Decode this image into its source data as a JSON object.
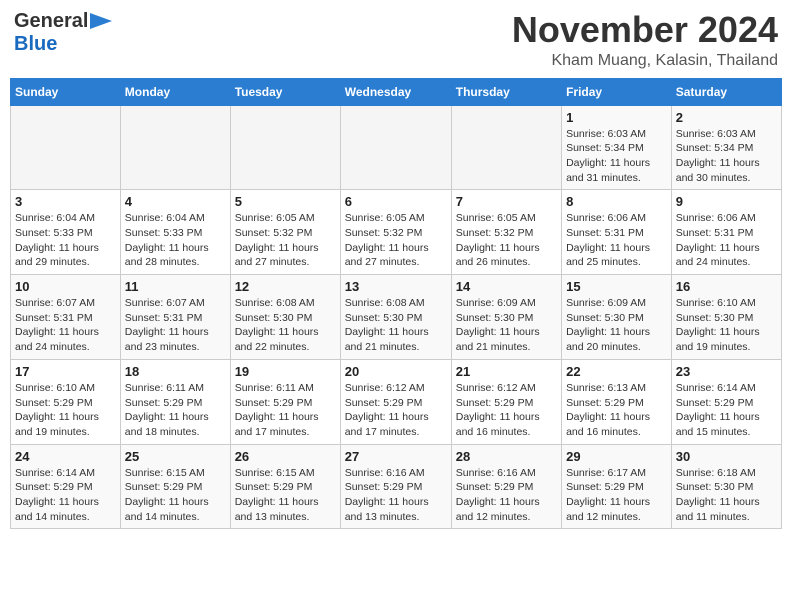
{
  "header": {
    "logo_general": "General",
    "logo_blue": "Blue",
    "month_title": "November 2024",
    "location": "Kham Muang, Kalasin, Thailand"
  },
  "weekdays": [
    "Sunday",
    "Monday",
    "Tuesday",
    "Wednesday",
    "Thursday",
    "Friday",
    "Saturday"
  ],
  "weeks": [
    [
      {
        "day": "",
        "info": ""
      },
      {
        "day": "",
        "info": ""
      },
      {
        "day": "",
        "info": ""
      },
      {
        "day": "",
        "info": ""
      },
      {
        "day": "",
        "info": ""
      },
      {
        "day": "1",
        "info": "Sunrise: 6:03 AM\nSunset: 5:34 PM\nDaylight: 11 hours\nand 31 minutes."
      },
      {
        "day": "2",
        "info": "Sunrise: 6:03 AM\nSunset: 5:34 PM\nDaylight: 11 hours\nand 30 minutes."
      }
    ],
    [
      {
        "day": "3",
        "info": "Sunrise: 6:04 AM\nSunset: 5:33 PM\nDaylight: 11 hours\nand 29 minutes."
      },
      {
        "day": "4",
        "info": "Sunrise: 6:04 AM\nSunset: 5:33 PM\nDaylight: 11 hours\nand 28 minutes."
      },
      {
        "day": "5",
        "info": "Sunrise: 6:05 AM\nSunset: 5:32 PM\nDaylight: 11 hours\nand 27 minutes."
      },
      {
        "day": "6",
        "info": "Sunrise: 6:05 AM\nSunset: 5:32 PM\nDaylight: 11 hours\nand 27 minutes."
      },
      {
        "day": "7",
        "info": "Sunrise: 6:05 AM\nSunset: 5:32 PM\nDaylight: 11 hours\nand 26 minutes."
      },
      {
        "day": "8",
        "info": "Sunrise: 6:06 AM\nSunset: 5:31 PM\nDaylight: 11 hours\nand 25 minutes."
      },
      {
        "day": "9",
        "info": "Sunrise: 6:06 AM\nSunset: 5:31 PM\nDaylight: 11 hours\nand 24 minutes."
      }
    ],
    [
      {
        "day": "10",
        "info": "Sunrise: 6:07 AM\nSunset: 5:31 PM\nDaylight: 11 hours\nand 24 minutes."
      },
      {
        "day": "11",
        "info": "Sunrise: 6:07 AM\nSunset: 5:31 PM\nDaylight: 11 hours\nand 23 minutes."
      },
      {
        "day": "12",
        "info": "Sunrise: 6:08 AM\nSunset: 5:30 PM\nDaylight: 11 hours\nand 22 minutes."
      },
      {
        "day": "13",
        "info": "Sunrise: 6:08 AM\nSunset: 5:30 PM\nDaylight: 11 hours\nand 21 minutes."
      },
      {
        "day": "14",
        "info": "Sunrise: 6:09 AM\nSunset: 5:30 PM\nDaylight: 11 hours\nand 21 minutes."
      },
      {
        "day": "15",
        "info": "Sunrise: 6:09 AM\nSunset: 5:30 PM\nDaylight: 11 hours\nand 20 minutes."
      },
      {
        "day": "16",
        "info": "Sunrise: 6:10 AM\nSunset: 5:30 PM\nDaylight: 11 hours\nand 19 minutes."
      }
    ],
    [
      {
        "day": "17",
        "info": "Sunrise: 6:10 AM\nSunset: 5:29 PM\nDaylight: 11 hours\nand 19 minutes."
      },
      {
        "day": "18",
        "info": "Sunrise: 6:11 AM\nSunset: 5:29 PM\nDaylight: 11 hours\nand 18 minutes."
      },
      {
        "day": "19",
        "info": "Sunrise: 6:11 AM\nSunset: 5:29 PM\nDaylight: 11 hours\nand 17 minutes."
      },
      {
        "day": "20",
        "info": "Sunrise: 6:12 AM\nSunset: 5:29 PM\nDaylight: 11 hours\nand 17 minutes."
      },
      {
        "day": "21",
        "info": "Sunrise: 6:12 AM\nSunset: 5:29 PM\nDaylight: 11 hours\nand 16 minutes."
      },
      {
        "day": "22",
        "info": "Sunrise: 6:13 AM\nSunset: 5:29 PM\nDaylight: 11 hours\nand 16 minutes."
      },
      {
        "day": "23",
        "info": "Sunrise: 6:14 AM\nSunset: 5:29 PM\nDaylight: 11 hours\nand 15 minutes."
      }
    ],
    [
      {
        "day": "24",
        "info": "Sunrise: 6:14 AM\nSunset: 5:29 PM\nDaylight: 11 hours\nand 14 minutes."
      },
      {
        "day": "25",
        "info": "Sunrise: 6:15 AM\nSunset: 5:29 PM\nDaylight: 11 hours\nand 14 minutes."
      },
      {
        "day": "26",
        "info": "Sunrise: 6:15 AM\nSunset: 5:29 PM\nDaylight: 11 hours\nand 13 minutes."
      },
      {
        "day": "27",
        "info": "Sunrise: 6:16 AM\nSunset: 5:29 PM\nDaylight: 11 hours\nand 13 minutes."
      },
      {
        "day": "28",
        "info": "Sunrise: 6:16 AM\nSunset: 5:29 PM\nDaylight: 11 hours\nand 12 minutes."
      },
      {
        "day": "29",
        "info": "Sunrise: 6:17 AM\nSunset: 5:29 PM\nDaylight: 11 hours\nand 12 minutes."
      },
      {
        "day": "30",
        "info": "Sunrise: 6:18 AM\nSunset: 5:30 PM\nDaylight: 11 hours\nand 11 minutes."
      }
    ]
  ]
}
